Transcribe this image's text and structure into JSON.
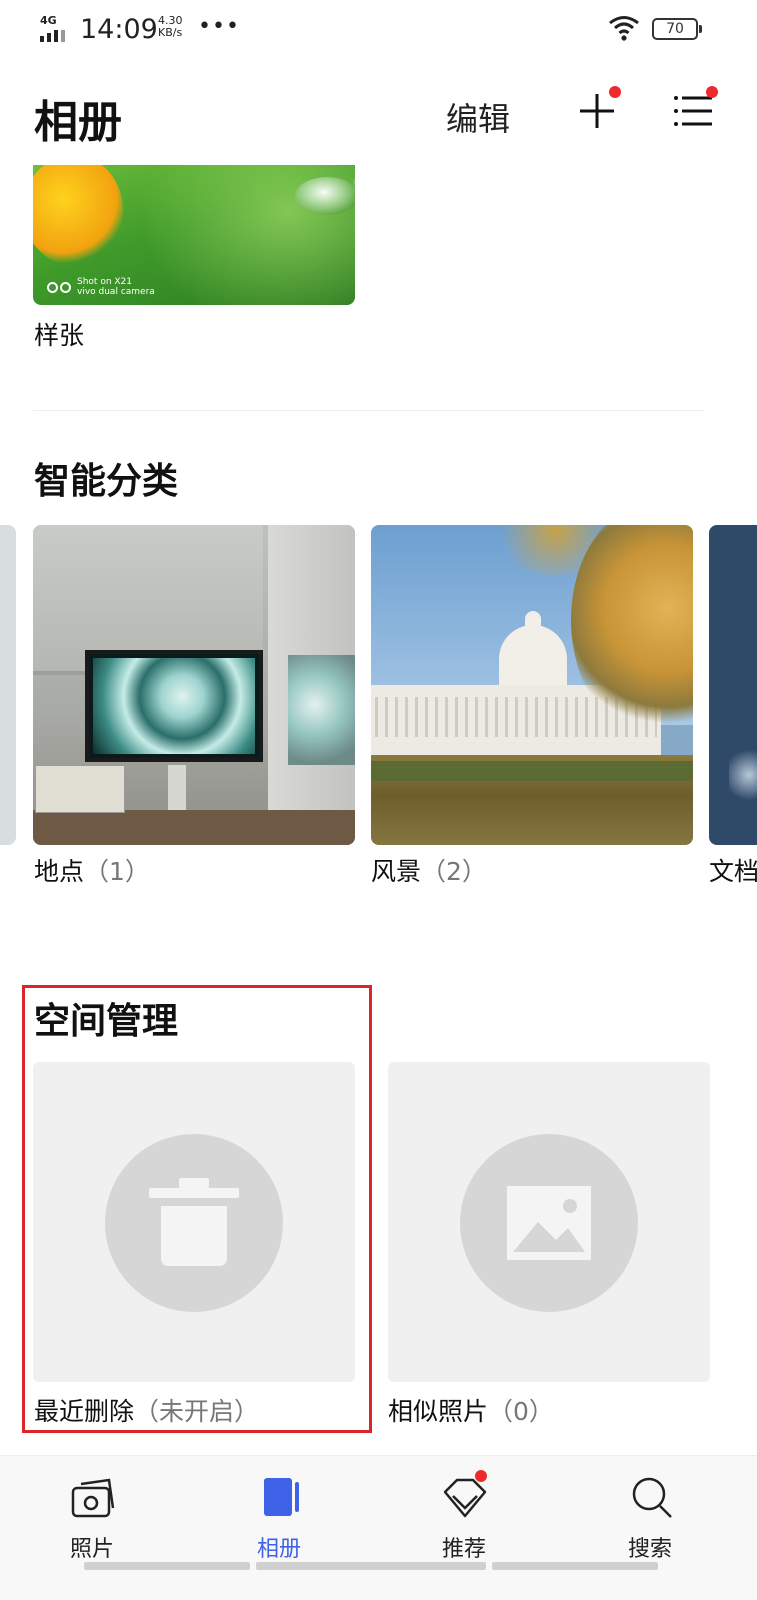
{
  "status_bar": {
    "network": "4G",
    "time": "14:09",
    "speed_value": "4.30",
    "speed_unit": "KB/s",
    "more": "•••",
    "battery": "70"
  },
  "header": {
    "title": "相册",
    "edit_label": "编辑"
  },
  "sample_album": {
    "label": "样张",
    "watermark_line1": "Shot on X21",
    "watermark_line2": "vivo dual camera"
  },
  "smart_categories": {
    "title": "智能分类",
    "items": [
      {
        "name": "地点",
        "count": "（1）"
      },
      {
        "name": "风景",
        "count": "（2）"
      },
      {
        "name": "文档"
      }
    ]
  },
  "space_management": {
    "title": "空间管理",
    "items": [
      {
        "name": "最近删除",
        "status": "（未开启）"
      },
      {
        "name": "相似照片",
        "status": "（0）"
      }
    ]
  },
  "bottom_nav": {
    "items": [
      {
        "label": "照片"
      },
      {
        "label": "相册"
      },
      {
        "label": "推荐"
      },
      {
        "label": "搜索"
      }
    ],
    "active": "相册"
  },
  "colors": {
    "accent": "#3f63e8",
    "notification_dot": "#ee2a2a",
    "highlight_border": "#d9262b"
  },
  "icons": [
    "add-icon",
    "menu-icon",
    "camera-icon",
    "albums-icon",
    "recommend-icon",
    "search-icon",
    "trash-icon",
    "image-icon",
    "wifi-icon",
    "signal-icon",
    "battery-icon"
  ]
}
